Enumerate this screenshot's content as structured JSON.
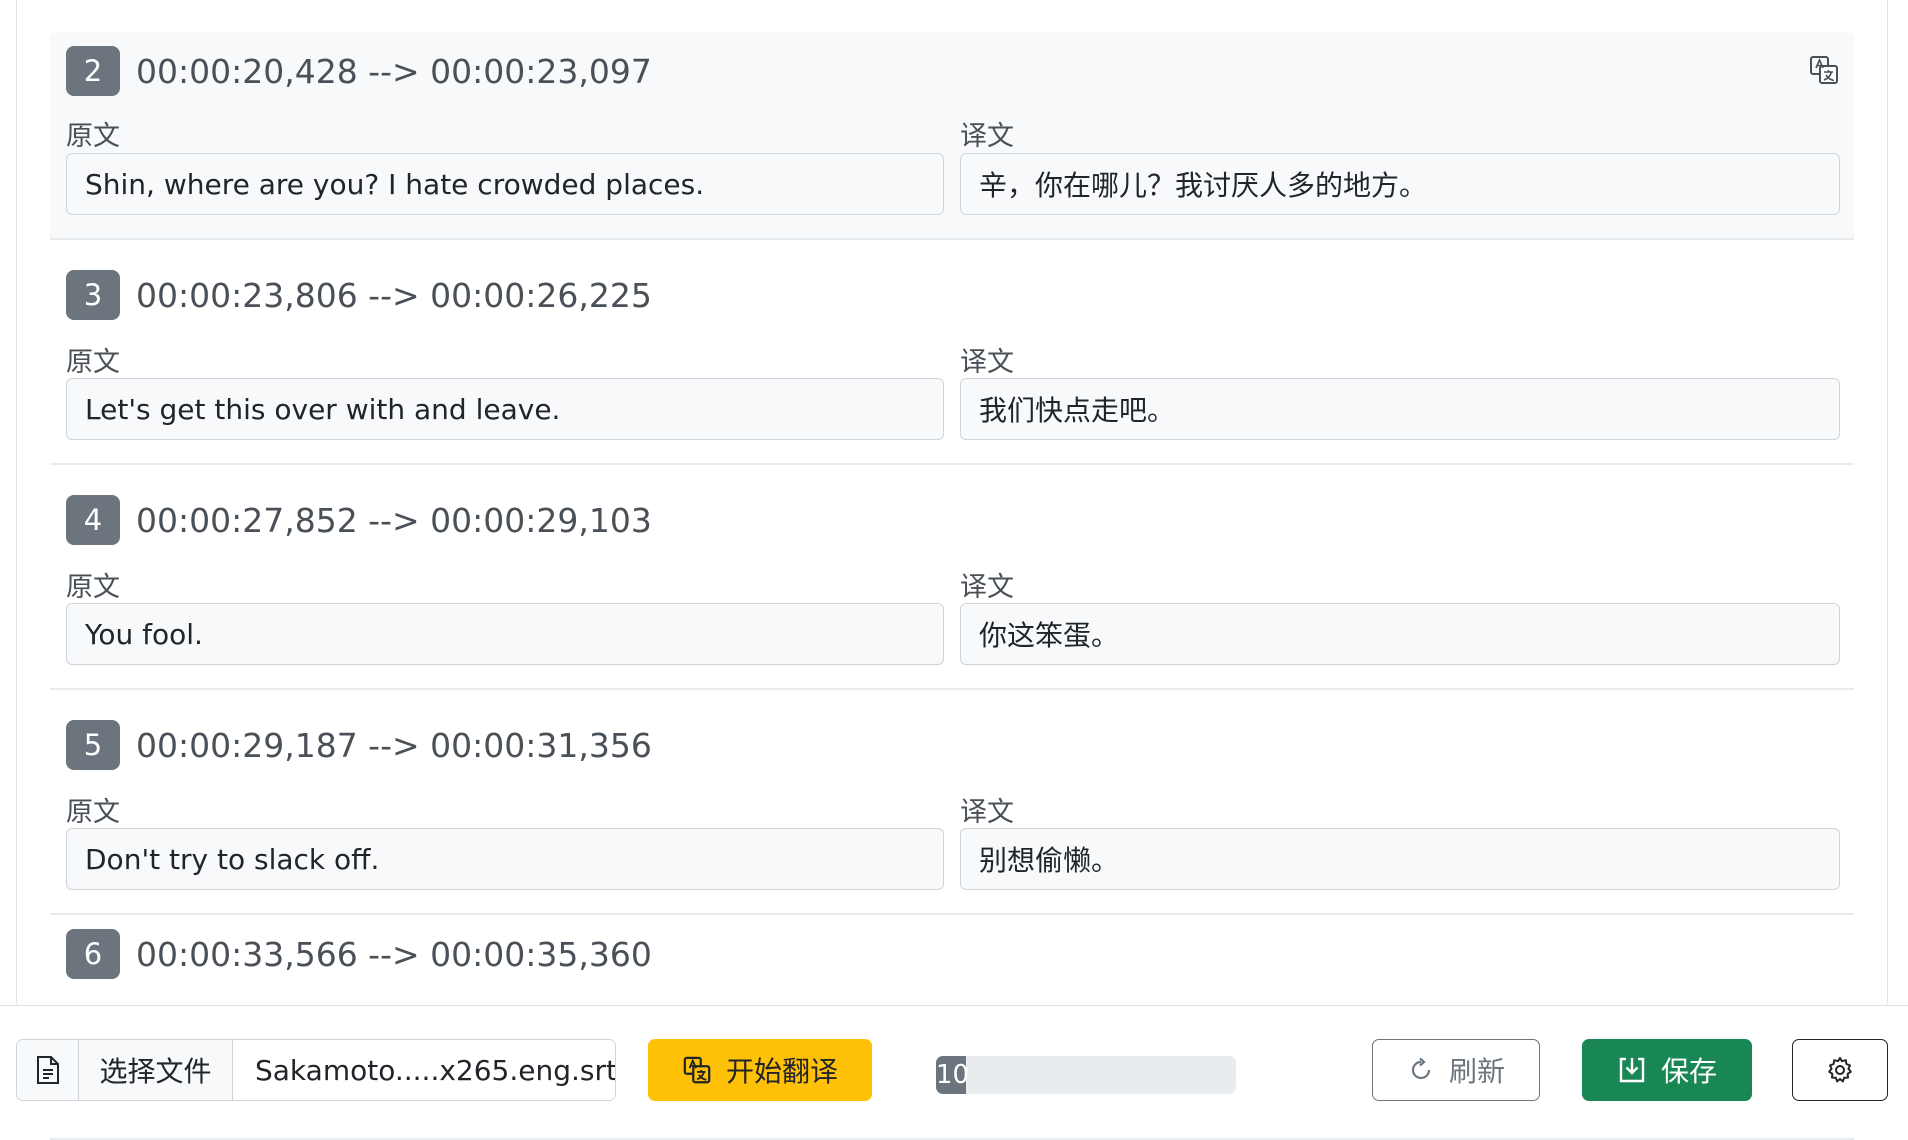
{
  "entries": [
    {
      "index": "2",
      "time": "00:00:20,428 --> 00:00:23,097",
      "source": "Shin, where are you? I hate crowded places.",
      "target": "辛，你在哪儿？我讨厌人多的地方。"
    },
    {
      "index": "3",
      "time": "00:00:23,806 --> 00:00:26,225",
      "source": "Let's get this over with and leave.",
      "target": "我们快点走吧。"
    },
    {
      "index": "4",
      "time": "00:00:27,852 --> 00:00:29,103",
      "source": "You fool.",
      "target": "你这笨蛋。"
    },
    {
      "index": "5",
      "time": "00:00:29,187 --> 00:00:31,356",
      "source": "Don't try to slack off.",
      "target": "别想偷懒。"
    },
    {
      "index": "6",
      "time": "00:00:33,566 --> 00:00:35,360"
    }
  ],
  "labels": {
    "source": "原文",
    "target": "译文"
  },
  "toolbar": {
    "choose_file": "选择文件",
    "file_name": "Sakamoto.....x265.eng.srt",
    "translate": "开始翻译",
    "progress_text": "10",
    "progress_value": 0.1,
    "refresh": "刷新",
    "save": "保存"
  },
  "colors": {
    "translate": "#ffc107",
    "save": "#198754",
    "badge": "#6c757d"
  },
  "icons": {
    "file": "file-icon",
    "translate": "translate-icon",
    "refresh": "refresh-icon",
    "save": "save-icon",
    "settings": "gear-icon"
  }
}
